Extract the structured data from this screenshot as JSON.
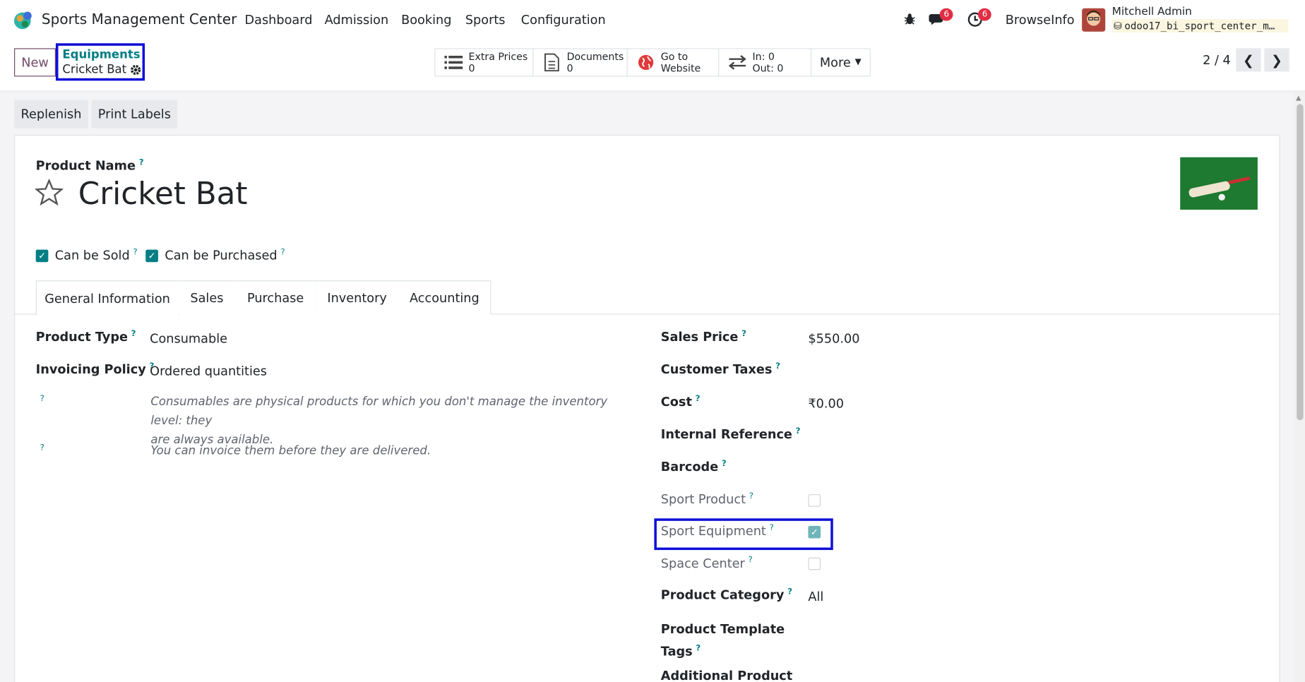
{
  "navbar": {
    "app_name": "Sports Management Center",
    "menus": [
      "Dashboard",
      "Admission",
      "Booking",
      "Sports",
      "Configuration"
    ],
    "messages_count": "6",
    "activities_count": "6",
    "company": "BrowseInfo",
    "user_name": "Mitchell Admin",
    "database": "odoo17_bi_sport_center_m…"
  },
  "control": {
    "new_label": "New",
    "breadcrumb_parent": "Equipments",
    "breadcrumb_current": "Cricket Bat",
    "smart_buttons": [
      {
        "label": "Extra Prices",
        "value": "0"
      },
      {
        "label": "Documents",
        "value": "0"
      },
      {
        "label": "Go to",
        "value": "Website"
      },
      {
        "label": "In: 0",
        "value": "Out: 0"
      }
    ],
    "more_label": "More",
    "pager": "2 / 4"
  },
  "actions": {
    "replenish": "Replenish",
    "print_labels": "Print Labels"
  },
  "form": {
    "product_name_label": "Product Name",
    "product_name": "Cricket Bat",
    "can_be_sold": "Can be Sold",
    "can_be_purchased": "Can be Purchased",
    "tabs": [
      "General Information",
      "Sales",
      "Purchase",
      "Inventory",
      "Accounting"
    ],
    "left": {
      "product_type_label": "Product Type",
      "product_type": "Consumable",
      "invoicing_policy_label": "Invoicing Policy",
      "invoicing_policy": "Ordered quantities",
      "hint1_line1": "Consumables are physical products for which you don't manage the inventory level: they",
      "hint1_line2": "are always available.",
      "hint2": "You can invoice them before they are delivered."
    },
    "right": {
      "sales_price_label": "Sales Price",
      "sales_price": "$550.00",
      "customer_taxes_label": "Customer Taxes",
      "cost_label": "Cost",
      "cost": "₹0.00",
      "internal_reference_label": "Internal Reference",
      "barcode_label": "Barcode",
      "sport_product_label": "Sport Product",
      "sport_equipment_label": "Sport Equipment",
      "space_center_label": "Space Center",
      "product_category_label": "Product Category",
      "product_category": "All",
      "template_tags_label_1": "Product Template",
      "template_tags_label_2": "Tags",
      "additional_product_label": "Additional Product"
    }
  },
  "colors": {
    "accent": "#017e84",
    "brand": "#714b67",
    "highlight": "#1010d8"
  }
}
